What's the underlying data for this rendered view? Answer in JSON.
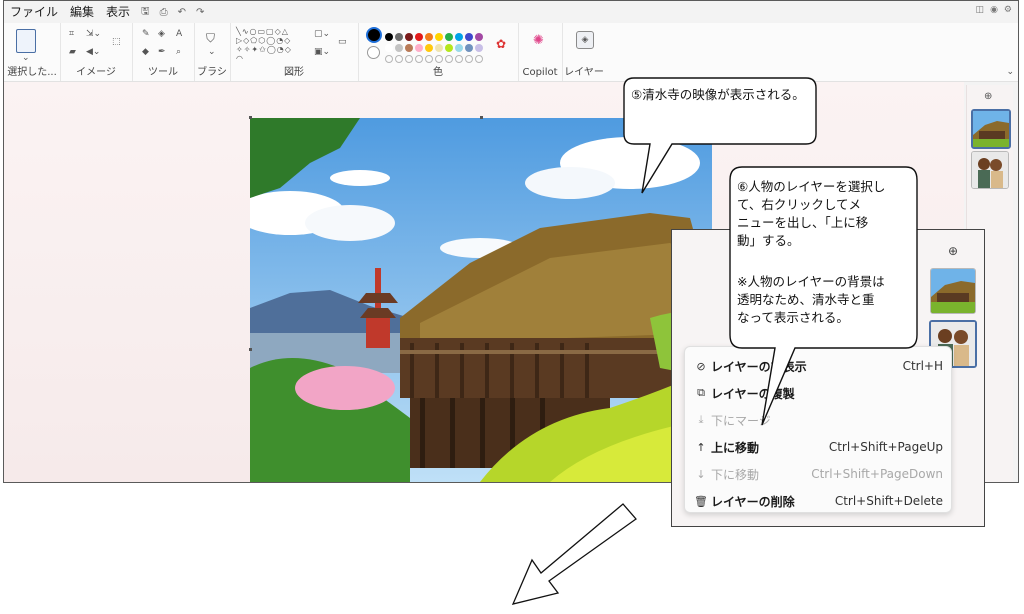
{
  "menu": {
    "file": "ファイル",
    "edit": "編集",
    "view": "表示"
  },
  "ribbon": {
    "selection": "選択した...",
    "image": "イメージ",
    "tools": "ツール",
    "brush": "ブラシ",
    "shapes": "図形",
    "colors": "色",
    "copilot": "Copilot",
    "layers": "レイヤー"
  },
  "palette": {
    "row1": [
      "#000000",
      "#6b6b6b",
      "#7a1a1a",
      "#e21b1b",
      "#f27c1b",
      "#ffd400",
      "#27b04a",
      "#00a2e8",
      "#3f48cc",
      "#a349a4"
    ],
    "row2": [
      "#ffffff",
      "#c3c3c3",
      "#b97a57",
      "#ffaec9",
      "#ffc90e",
      "#efe4b0",
      "#b5e61d",
      "#99d9ea",
      "#7092be",
      "#c8bfe7"
    ]
  },
  "context_menu": {
    "items": [
      {
        "label": "レイヤーの非表示",
        "shortcut": "Ctrl+H",
        "icon": "eye-off-icon",
        "enabled": true
      },
      {
        "label": "レイヤーの複製",
        "shortcut": "",
        "icon": "duplicate-icon",
        "enabled": true
      },
      {
        "label": "下にマージ",
        "shortcut": "",
        "icon": "merge-down-icon",
        "enabled": false
      },
      {
        "label": "上に移動",
        "shortcut": "Ctrl+Shift+PageUp",
        "icon": "arrow-up-icon",
        "enabled": true
      },
      {
        "label": "下に移動",
        "shortcut": "Ctrl+Shift+PageDown",
        "icon": "arrow-down-icon",
        "enabled": false
      },
      {
        "label": "レイヤーの削除",
        "shortcut": "Ctrl+Shift+Delete",
        "icon": "trash-icon",
        "enabled": true
      }
    ]
  },
  "callouts": {
    "c5": "⑤清水寺の映像が表示される。",
    "c6_line1": "⑥人物のレイヤーを選択し\nて、右クリックしてメ\nニューを出し、「上に移\n動」する。",
    "c6_line2": "※人物のレイヤーの背景は\n透明なため、清水寺と重\nなって表示される。"
  },
  "icons": {
    "add_layer": "plus-circle-icon",
    "colors_accent": "#1e6fd9"
  }
}
